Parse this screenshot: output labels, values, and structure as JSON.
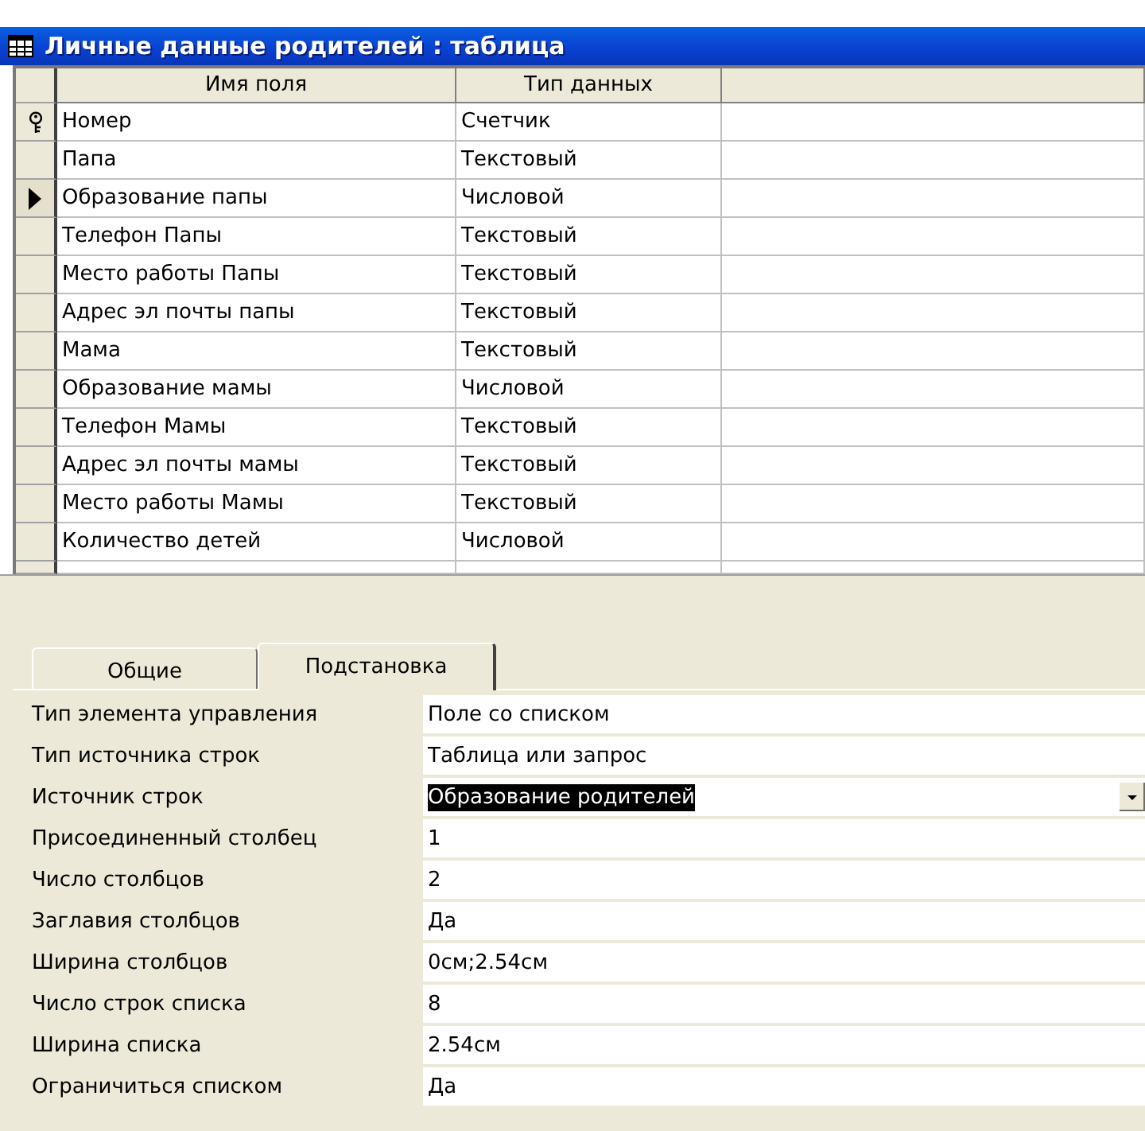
{
  "window": {
    "title": "Личные данные родителей : таблица"
  },
  "table": {
    "columns": [
      "Имя поля",
      "Тип данных"
    ],
    "rows": [
      {
        "name": "Номер",
        "type": "Счетчик",
        "primary_key": true,
        "selected": false
      },
      {
        "name": "Папа",
        "type": "Текстовый",
        "primary_key": false,
        "selected": false
      },
      {
        "name": "Образование папы",
        "type": "Числовой",
        "primary_key": false,
        "selected": true
      },
      {
        "name": "Телефон Папы",
        "type": "Текстовый",
        "primary_key": false,
        "selected": false
      },
      {
        "name": "Место работы Папы",
        "type": "Текстовый",
        "primary_key": false,
        "selected": false
      },
      {
        "name": "Адрес эл почты папы",
        "type": "Текстовый",
        "primary_key": false,
        "selected": false
      },
      {
        "name": "Мама",
        "type": "Текстовый",
        "primary_key": false,
        "selected": false
      },
      {
        "name": "Образование мамы",
        "type": "Числовой",
        "primary_key": false,
        "selected": false
      },
      {
        "name": "Телефон Мамы",
        "type": "Текстовый",
        "primary_key": false,
        "selected": false
      },
      {
        "name": "Адрес эл почты мамы",
        "type": "Текстовый",
        "primary_key": false,
        "selected": false
      },
      {
        "name": "Место работы Мамы",
        "type": "Текстовый",
        "primary_key": false,
        "selected": false
      },
      {
        "name": "Количество детей",
        "type": "Числовой",
        "primary_key": false,
        "selected": false
      }
    ]
  },
  "tabs": [
    {
      "label": "Общие",
      "selected": false
    },
    {
      "label": "Подстановка",
      "selected": true
    }
  ],
  "properties": [
    {
      "label": "Тип элемента управления",
      "value": "Поле со списком",
      "focused": false
    },
    {
      "label": "Тип источника строк",
      "value": "Таблица или запрос",
      "focused": false
    },
    {
      "label": "Источник строк",
      "value": "Образование родителей",
      "focused": true
    },
    {
      "label": "Присоединенный столбец",
      "value": "1",
      "focused": false
    },
    {
      "label": "Число столбцов",
      "value": "2",
      "focused": false
    },
    {
      "label": "Заглавия столбцов",
      "value": "Да",
      "focused": false
    },
    {
      "label": "Ширина столбцов",
      "value": "0см;2.54см",
      "focused": false
    },
    {
      "label": "Число строк списка",
      "value": "8",
      "focused": false
    },
    {
      "label": "Ширина списка",
      "value": "2.54см",
      "focused": false
    },
    {
      "label": "Ограничиться списком",
      "value": "Да",
      "focused": false
    }
  ]
}
